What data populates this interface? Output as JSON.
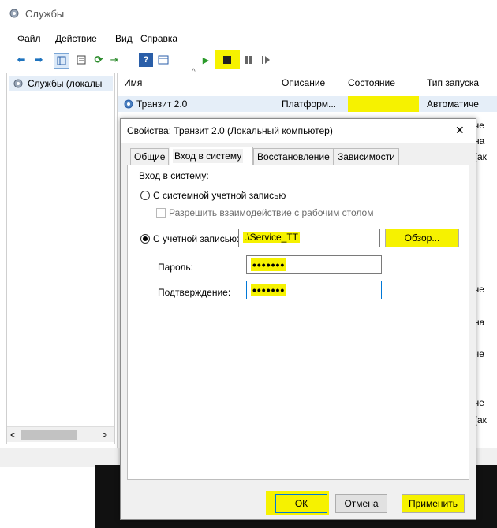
{
  "window": {
    "title": "Службы"
  },
  "menu": [
    "Файл",
    "Действие",
    "Вид",
    "Справка"
  ],
  "tree": {
    "root_label": "Службы (локалы"
  },
  "list": {
    "columns": [
      "Имя",
      "Описание",
      "Состояние",
      "Тип запуска"
    ],
    "row": {
      "name": "Транзит 2.0",
      "description": "Платформ...",
      "state": "",
      "startup": "Автоматиче"
    },
    "edge_fragments": [
      "че",
      "на",
      "(ак",
      "че",
      "на",
      "че",
      "че",
      "(ак"
    ]
  },
  "dialog": {
    "title": "Свойства: Транзит 2.0 (Локальный компьютер)",
    "close_glyph": "✕",
    "tabs": [
      "Общие",
      "Вход в систему",
      "Восстановление",
      "Зависимости"
    ],
    "active_tab": 1,
    "group_label": "Вход в систему:",
    "radio_system": "С системной учетной записью",
    "checkbox_desktop": "Разрешить взаимодействие с рабочим столом",
    "radio_account": "С учетной записью:",
    "account_value": ".\\Service_TT",
    "browse_label": "Обзор...",
    "password_label": "Пароль:",
    "password_value": "•••••••",
    "confirm_label": "Подтверждение:",
    "confirm_value": "•••••••",
    "ok_label": "ОК",
    "cancel_label": "Отмена",
    "apply_label": "Применить"
  },
  "colors": {
    "highlight": "#f6f200",
    "focus_border": "#0078d7"
  }
}
